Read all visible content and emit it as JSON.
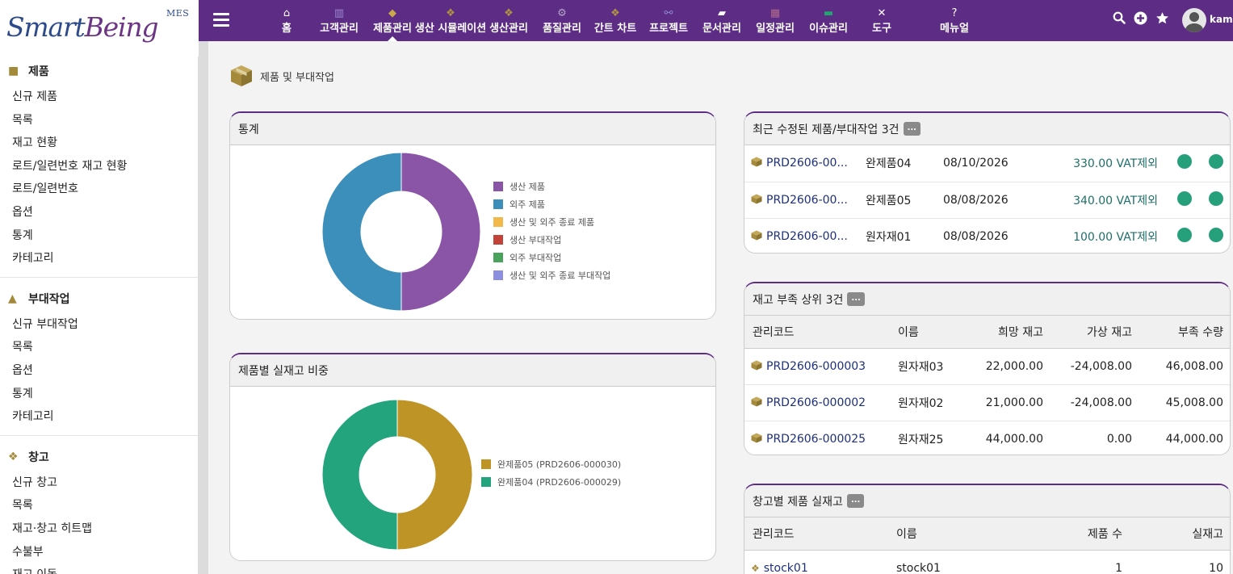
{
  "logo": {
    "smart": "Smart",
    "being": "Being",
    "mes": "MES"
  },
  "nav": {
    "items": [
      {
        "label": "홈",
        "icon": "home-icon",
        "glyph": "⌂"
      },
      {
        "label": "고객관리",
        "icon": "building-icon",
        "glyph": "▥"
      },
      {
        "label": "제품관리",
        "icon": "cube-icon",
        "glyph": "◆",
        "active": true
      },
      {
        "label": "생산 시뮬레이션",
        "icon": "cubes-icon",
        "glyph": "❖"
      },
      {
        "label": "생산관리",
        "icon": "cubes-icon",
        "glyph": "❖"
      },
      {
        "label": "품질관리",
        "icon": "cogs-icon",
        "glyph": "⚙"
      },
      {
        "label": "간트 차트",
        "icon": "cubes-icon",
        "glyph": "❖"
      },
      {
        "label": "프로젝트",
        "icon": "sitemap-icon",
        "glyph": "⚯"
      },
      {
        "label": "문서관리",
        "icon": "folder-open-icon",
        "glyph": "▰"
      },
      {
        "label": "일정관리",
        "icon": "calendar-icon",
        "glyph": "▦"
      },
      {
        "label": "이슈관리",
        "icon": "ticket-icon",
        "glyph": "▬"
      },
      {
        "label": "도구",
        "icon": "tools-icon",
        "glyph": "✕"
      },
      {
        "label": "메뉴얼",
        "icon": "question-icon",
        "glyph": "?"
      }
    ],
    "username": "kame",
    "colors": {
      "bar": "#5d2d86"
    }
  },
  "sidebar": {
    "sections": [
      {
        "title": "제품",
        "icon": "cube-icon",
        "items": [
          "신규 제품",
          "목록",
          "재고 현황",
          "로트/일련번호 재고 현황",
          "로트/일련번호",
          "옵션",
          "통계",
          "카테고리"
        ]
      },
      {
        "title": "부대작업",
        "icon": "worker-icon",
        "items": [
          "신규 부대작업",
          "목록",
          "옵션",
          "통계",
          "카테고리"
        ]
      },
      {
        "title": "창고",
        "icon": "boxes-icon",
        "items": [
          "신규 창고",
          "목록",
          "재고·창고 히트맵",
          "수불부",
          "재고 이동"
        ]
      }
    ]
  },
  "page": {
    "title": "제품 및 부대작업"
  },
  "stats_panel": {
    "title": "통계",
    "legend": [
      {
        "label": "생산 제품",
        "color": "#8a55a6"
      },
      {
        "label": "외주 제품",
        "color": "#3d8fbb"
      },
      {
        "label": "생산 및 외주 종료 제품",
        "color": "#f3b84a"
      },
      {
        "label": "생산 부대작업",
        "color": "#c3423a"
      },
      {
        "label": "외주 부대작업",
        "color": "#4aa35a"
      },
      {
        "label": "생산 및 외주 종료 부대작업",
        "color": "#8e8ee0"
      }
    ]
  },
  "stock_panel": {
    "title": "제품별 실재고 비중",
    "legend": [
      {
        "label": "완제품05 (PRD2606-000030)",
        "color": "#bd9425"
      },
      {
        "label": "완제품04 (PRD2606-000029)",
        "color": "#24a47c"
      }
    ]
  },
  "recent_panel": {
    "title": "최근 수정된 제품/부대작업 3건",
    "more": "...",
    "rows": [
      {
        "code": "PRD2606-00...",
        "name": "완제품04",
        "date": "08/10/2026",
        "price": "330.00 VAT제외"
      },
      {
        "code": "PRD2606-00...",
        "name": "완제품05",
        "date": "08/08/2026",
        "price": "340.00 VAT제외"
      },
      {
        "code": "PRD2606-00...",
        "name": "원자재01",
        "date": "08/08/2026",
        "price": "100.00 VAT제외"
      }
    ]
  },
  "shortage_panel": {
    "title": "재고 부족 상위 3건",
    "more": "...",
    "headers": [
      "관리코드",
      "이름",
      "희망 재고",
      "가상 재고",
      "부족 수량"
    ],
    "rows": [
      {
        "code": "PRD2606-000003",
        "name": "원자재03",
        "desired": "22,000.00",
        "virtual": "-24,008.00",
        "short": "46,008.00"
      },
      {
        "code": "PRD2606-000002",
        "name": "원자재02",
        "desired": "21,000.00",
        "virtual": "-24,008.00",
        "short": "45,008.00"
      },
      {
        "code": "PRD2606-000025",
        "name": "원자재25",
        "desired": "44,000.00",
        "virtual": "0.00",
        "short": "44,000.00"
      }
    ]
  },
  "warehouse_panel": {
    "title": "창고별 제품 실재고",
    "more": "...",
    "headers": [
      "관리코드",
      "이름",
      "제품 수",
      "실재고"
    ],
    "rows": [
      {
        "code": "stock01",
        "name": "stock01",
        "count": "1",
        "qty": "10"
      }
    ]
  }
}
